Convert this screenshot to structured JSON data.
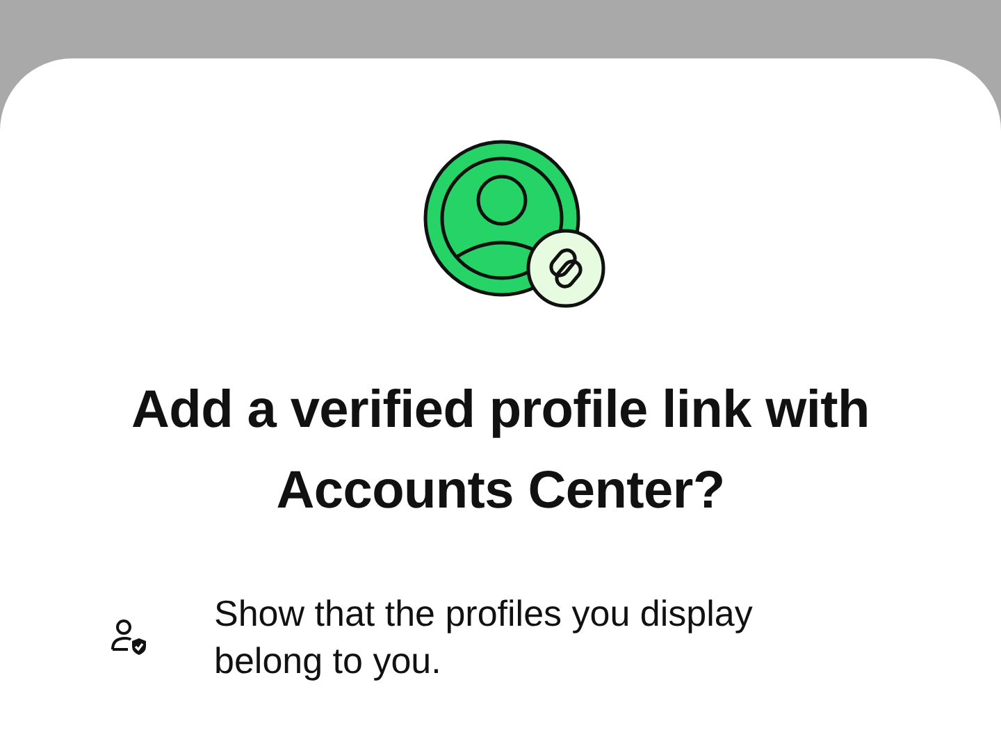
{
  "sheet": {
    "title": "Add a verified profile link with Accounts Center?",
    "features": [
      {
        "text": "Show that the profiles you display belong to you."
      }
    ]
  }
}
